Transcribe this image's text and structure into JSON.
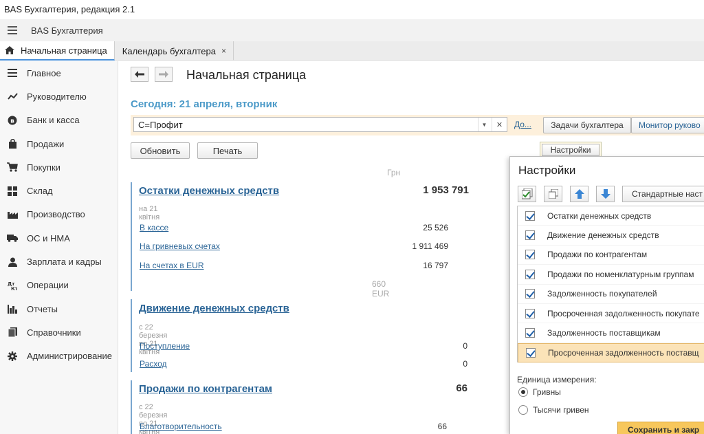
{
  "window": {
    "title": "BAS Бухгалтерия, редакция 2.1"
  },
  "app": {
    "name": "BAS Бухгалтерия"
  },
  "tabs": [
    {
      "label": "Начальная страница"
    },
    {
      "label": "Календарь бухгалтера",
      "close": "×"
    }
  ],
  "sidebar": {
    "items": [
      {
        "label": "Главное",
        "icon": "list-icon"
      },
      {
        "label": "Руководителю",
        "icon": "trend-icon"
      },
      {
        "label": "Банк и касса",
        "icon": "coin-icon"
      },
      {
        "label": "Продажи",
        "icon": "bag-icon"
      },
      {
        "label": "Покупки",
        "icon": "cart-icon"
      },
      {
        "label": "Склад",
        "icon": "grid-icon"
      },
      {
        "label": "Производство",
        "icon": "factory-icon"
      },
      {
        "label": "ОС и НМА",
        "icon": "truck-icon"
      },
      {
        "label": "Зарплата и кадры",
        "icon": "person-icon"
      },
      {
        "label": "Операции",
        "icon": "dtkt-icon"
      },
      {
        "label": "Отчеты",
        "icon": "bar-chart-icon"
      },
      {
        "label": "Справочники",
        "icon": "book-icon"
      },
      {
        "label": "Администрирование",
        "icon": "gear-icon"
      }
    ]
  },
  "page": {
    "title": "Начальная страница",
    "today": "Сегодня: 21 апреля, вторник",
    "org_value": "С=Профит",
    "org_link": "До...",
    "tasks_button": "Задачи бухгалтера",
    "monitor_button": "Монитор руково",
    "refresh_button": "Обновить",
    "print_button": "Печать",
    "settings_button": "Настройки",
    "currency_header": "Грн"
  },
  "sections": {
    "cash": {
      "title": "Остатки денежных средств",
      "total": "1 953 791",
      "date": "на 21 квітня",
      "rows": [
        {
          "label": "В кассе",
          "value": "25 526"
        },
        {
          "label": "На гривневых счетах",
          "value": "1 911 469"
        },
        {
          "label": "На счетах в EUR",
          "value": "16 797"
        }
      ],
      "note": "660 EUR"
    },
    "flow": {
      "title": "Движение денежных средств",
      "date": "с 22 березня по 21 квітня",
      "rows": [
        {
          "label": "Поступление",
          "value": "0"
        },
        {
          "label": "Расход",
          "value": "0"
        }
      ]
    },
    "sales": {
      "title": "Продажи по контрагентам",
      "total": "66",
      "date": "с 22 березня по 21 квітня",
      "rows": [
        {
          "label": "Благотворительность",
          "value": "66"
        }
      ]
    }
  },
  "settings_panel": {
    "title": "Настройки",
    "standard_button": "Стандартные наст",
    "items": [
      {
        "label": "Остатки денежных средств",
        "checked": true
      },
      {
        "label": "Движение денежных средств",
        "checked": true
      },
      {
        "label": "Продажи по контрагентам",
        "checked": true
      },
      {
        "label": "Продажи по номенклатурным группам",
        "checked": true
      },
      {
        "label": "Задолженность покупателей",
        "checked": true
      },
      {
        "label": "Просроченная задолженность покупате",
        "checked": true
      },
      {
        "label": "Задолженность поставщикам",
        "checked": true
      },
      {
        "label": "Просроченная задолженность поставщ",
        "checked": true
      }
    ],
    "unit_label": "Единица измерения:",
    "unit_options": [
      {
        "label": "Гривны",
        "selected": true
      },
      {
        "label": "Тысячи гривен",
        "selected": false
      }
    ],
    "save_button": "Сохранить и закр"
  }
}
